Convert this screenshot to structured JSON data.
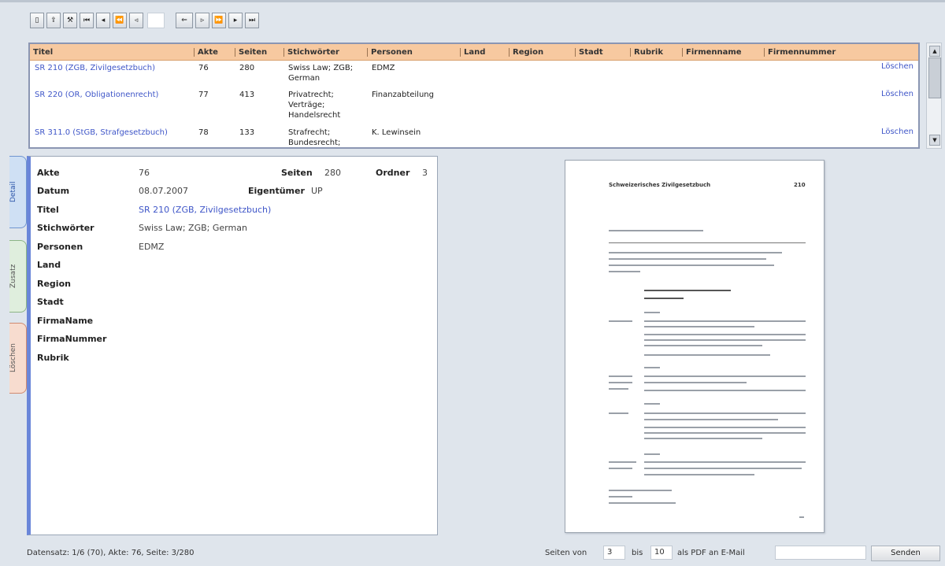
{
  "toolbar": {
    "buttons": [
      {
        "name": "select-column-button",
        "glyph": "▯"
      },
      {
        "name": "export-button",
        "glyph": "⇪"
      },
      {
        "name": "tools-button",
        "glyph": "⚒"
      },
      {
        "name": "first-record-button",
        "glyph": "⏮"
      },
      {
        "name": "previous-record-button",
        "glyph": "◂"
      },
      {
        "name": "jump-back-button",
        "glyph": "⏪"
      },
      {
        "name": "step-back-button",
        "glyph": "◃"
      }
    ],
    "record_input": "",
    "page_buttons": [
      {
        "name": "page-back-button",
        "glyph": "⇐"
      },
      {
        "name": "page-step-button",
        "glyph": "▹"
      },
      {
        "name": "page-jump-button",
        "glyph": "⏩"
      },
      {
        "name": "page-next-button",
        "glyph": "▸"
      },
      {
        "name": "page-last-button",
        "glyph": "⏭"
      }
    ]
  },
  "table": {
    "columns": [
      "Titel",
      "Akte",
      "Seiten",
      "Stichwörter",
      "Personen",
      "Land",
      "Region",
      "Stadt",
      "Rubrik",
      "Firmenname",
      "Firmennummer"
    ],
    "delete_label": "Löschen",
    "rows": [
      {
        "titel": "SR 210 (ZGB, Zivilgesetzbuch)",
        "akte": "76",
        "seiten": "280",
        "stichwoerter": "Swiss Law; ZGB; German",
        "personen": "EDMZ"
      },
      {
        "titel": "SR 220 (OR, Obligationenrecht)",
        "akte": "77",
        "seiten": "413",
        "stichwoerter": "Privatrecht; Verträge; Handelsrecht",
        "personen": "Finanzabteilung"
      },
      {
        "titel": "SR 311.0 (StGB, Strafgesetzbuch)",
        "akte": "78",
        "seiten": "133",
        "stichwoerter": "Strafrecht; Bundesrecht;",
        "personen": "K. Lewinsein"
      }
    ]
  },
  "tabs": {
    "detail": "Detail",
    "extra": "Zusatz",
    "delete": "Löschen"
  },
  "detail": {
    "akte_label": "Akte",
    "akte": "76",
    "seiten_label": "Seiten",
    "seiten": "280",
    "ordner_label": "Ordner",
    "ordner": "3",
    "datum_label": "Datum",
    "datum": "08.07.2007",
    "eigentuemer_label": "Eigentümer",
    "eigentuemer": "UP",
    "titel_label": "Titel",
    "titel": "SR 210 (ZGB, Zivilgesetzbuch)",
    "stichwoerter_label": "Stichwörter",
    "stichwoerter": "Swiss Law; ZGB; German",
    "personen_label": "Personen",
    "personen": "EDMZ",
    "land_label": "Land",
    "region_label": "Region",
    "stadt_label": "Stadt",
    "firmenname_label": "FirmaName",
    "firmennummer_label": "FirmaNummer",
    "rubrik_label": "Rubrik"
  },
  "preview": {
    "header_left": "Schweizerisches Zivilgesetzbuch",
    "header_right": "210"
  },
  "status": "Datensatz: 1/6 (70), Akte: 76, Seite: 3/280",
  "footer": {
    "pages_from_label": "Seiten von",
    "pages_from": "3",
    "pages_to_label": "bis",
    "pages_to": "10",
    "pdf_label": "als PDF an E-Mail",
    "email_value": "",
    "send_label": "Senden"
  }
}
